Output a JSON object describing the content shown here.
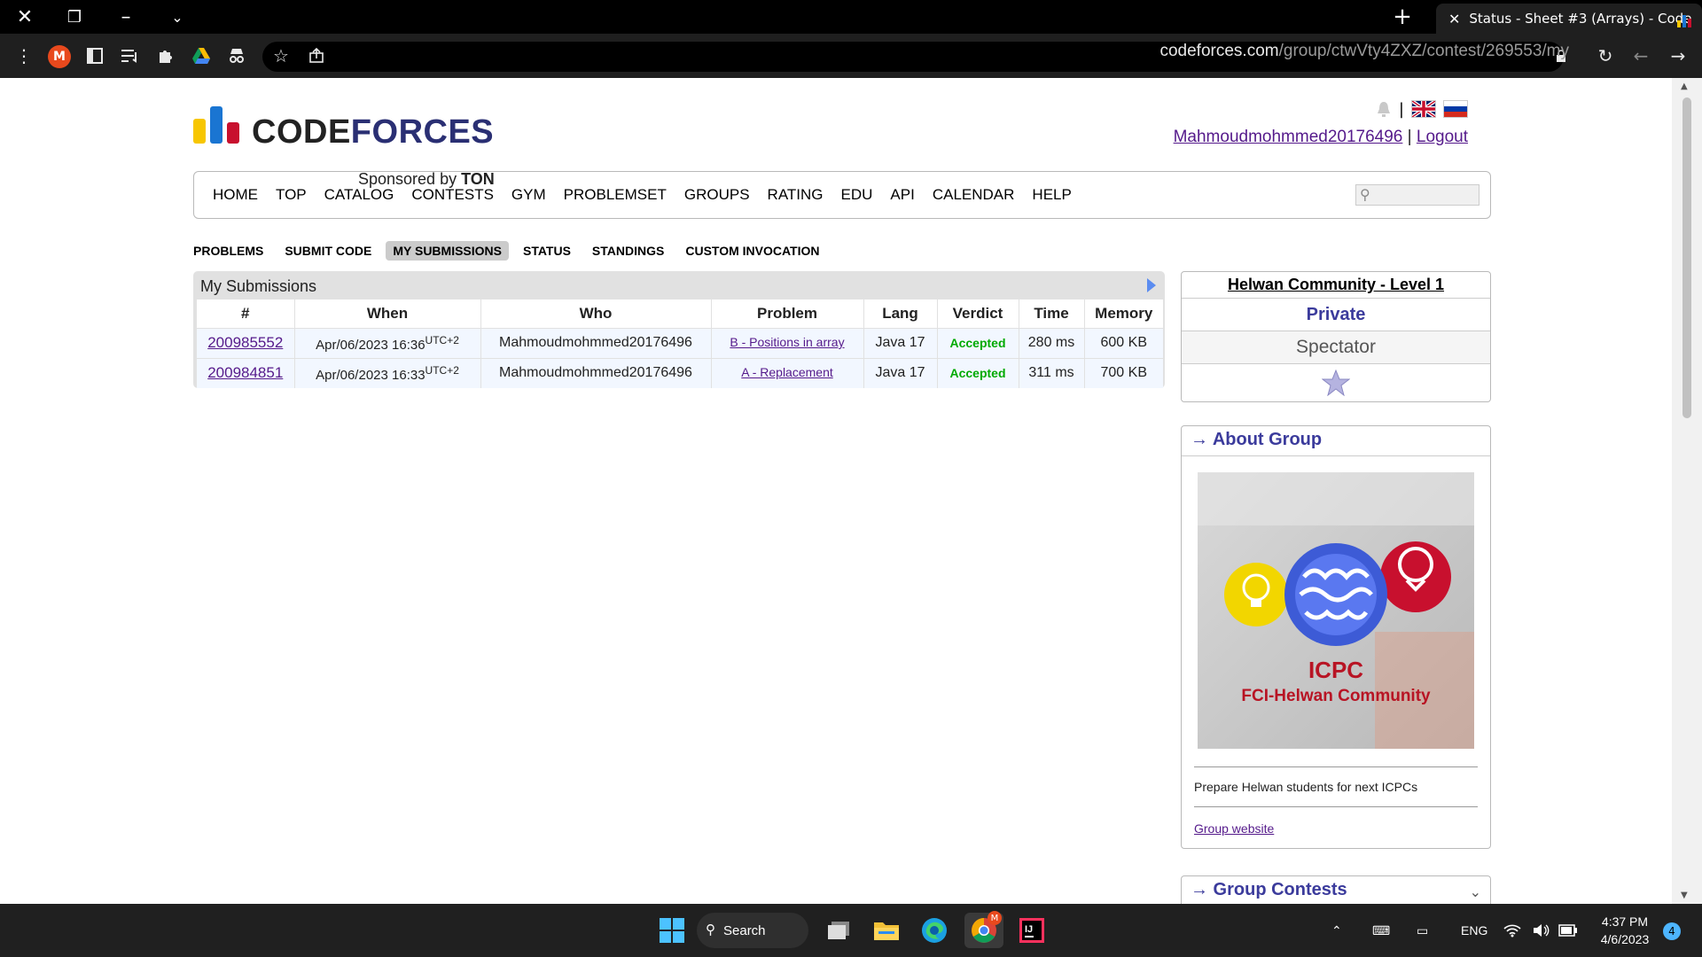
{
  "browser": {
    "tab_title": "Status - Sheet #3 (Arrays) - Code",
    "profile_initial": "M",
    "url_host": "codeforces.com",
    "url_path": "/group/ctwVty4ZXZ/contest/269553/my"
  },
  "site": {
    "logo_text_1": "CODE",
    "logo_text_2": "FORCES",
    "sponsor_prefix": "Sponsored by",
    "sponsor_name": "TON",
    "username": "Mahmoudmohmmed20176496",
    "separator": "|",
    "logout": "Logout"
  },
  "menu": {
    "items": [
      "HOME",
      "TOP",
      "CATALOG",
      "CONTESTS",
      "GYM",
      "PROBLEMSET",
      "GROUPS",
      "RATING",
      "EDU",
      "API",
      "CALENDAR",
      "HELP"
    ]
  },
  "subnav": {
    "items": [
      "PROBLEMS",
      "SUBMIT CODE",
      "MY SUBMISSIONS",
      "STATUS",
      "STANDINGS",
      "CUSTOM INVOCATION"
    ],
    "active": "MY SUBMISSIONS"
  },
  "submissions": {
    "title": "My Submissions",
    "headers": [
      "#",
      "When",
      "Who",
      "Problem",
      "Lang",
      "Verdict",
      "Time",
      "Memory"
    ],
    "rows": [
      {
        "id": "200985552",
        "when": "Apr/06/2023 16:36",
        "tz": "UTC+2",
        "who": "Mahmoudmohmmed20176496",
        "problem": "B - Positions in array",
        "lang": "Java 17",
        "verdict": "Accepted",
        "time": "280 ms",
        "memory": "600 KB"
      },
      {
        "id": "200984851",
        "when": "Apr/06/2023 16:33",
        "tz": "UTC+2",
        "who": "Mahmoudmohmmed20176496",
        "problem": "A - Replacement",
        "lang": "Java 17",
        "verdict": "Accepted",
        "time": "311 ms",
        "memory": "700 KB"
      }
    ]
  },
  "sidebar": {
    "group_name": "Helwan Community - Level 1",
    "privacy": "Private",
    "role": "Spectator",
    "about_title": "→ About Group",
    "image_title": "ICPC",
    "image_subtitle": "FCI-Helwan Community",
    "description": "Prepare Helwan students for next ICPCs",
    "website_link": "Group website",
    "contests_title": "→ Group Contests"
  },
  "taskbar": {
    "search_label": "Search",
    "lang": "ENG",
    "time": "4:37 PM",
    "date": "4/6/2023",
    "notification_count": "4",
    "chrome_badge": "M"
  },
  "colors": {
    "accent": "#3b3b9c",
    "link": "#551a8b",
    "accepted": "#00aa00"
  }
}
